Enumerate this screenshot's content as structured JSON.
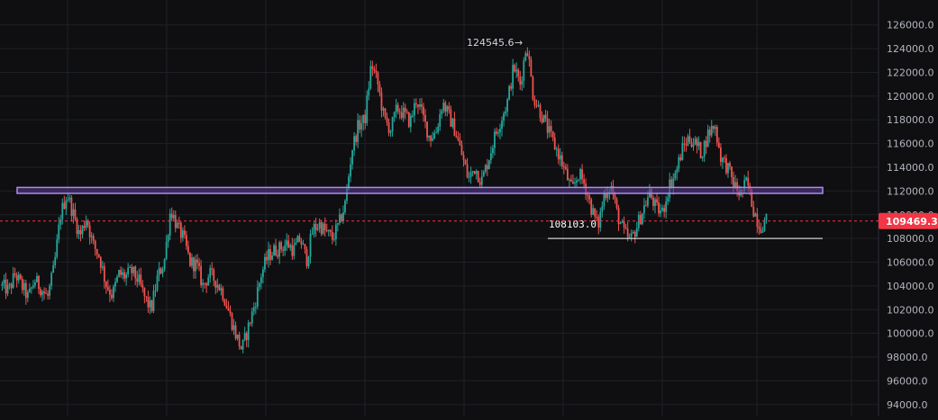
{
  "chart_data": {
    "type": "candlestick",
    "yticks": [
      "126000.0",
      "124000.0",
      "122000.0",
      "120000.0",
      "118000.0",
      "116000.0",
      "114000.0",
      "112000.0",
      "110000.0",
      "108000.0",
      "106000.0",
      "104000.0",
      "102000.0",
      "100000.0",
      "98000.0",
      "96000.0",
      "94000.0"
    ],
    "ytick_values": [
      126000,
      124000,
      122000,
      120000,
      118000,
      116000,
      114000,
      112000,
      110000,
      108000,
      106000,
      104000,
      102000,
      100000,
      98000,
      96000,
      94000
    ],
    "ylim": [
      93000,
      128100
    ],
    "current_price": 109469.3,
    "current_price_label": "109469.3",
    "high_label": "124545.6",
    "high_arrow": "→",
    "high_value": 124545.6,
    "support_label": "108103.0",
    "support_value": 108000,
    "resistance_zone": [
      111800,
      112300
    ],
    "price_path": [
      104000,
      103600,
      105000,
      104000,
      103000,
      104500,
      103800,
      103000,
      105500,
      110000,
      111800,
      110000,
      108200,
      109800,
      107500,
      106500,
      104200,
      103200,
      105000,
      104800,
      105200,
      104500,
      103000,
      102000,
      104800,
      106000,
      110500,
      109000,
      108000,
      106000,
      105800,
      104000,
      105000,
      104400,
      103500,
      101800,
      100000,
      98600,
      100500,
      102500,
      105000,
      106500,
      107000,
      107200,
      107600,
      107000,
      108000,
      106200,
      108800,
      109200,
      108500,
      108000,
      109200,
      111000,
      115500,
      117500,
      118000,
      122800,
      121000,
      118000,
      117200,
      119000,
      118500,
      117800,
      119800,
      118200,
      116500,
      117000,
      119500,
      118300,
      117000,
      115000,
      113000,
      114000,
      112800,
      114500,
      116500,
      118000,
      119500,
      122500,
      121000,
      124500,
      120000,
      118800,
      117500,
      116200,
      115000,
      113500,
      112000,
      113500,
      112500,
      110500,
      109000,
      111800,
      112500,
      110000,
      108500,
      107800,
      109000,
      110500,
      111800,
      110500,
      110200,
      112500,
      113500,
      115500,
      116500,
      116000,
      115200,
      116800,
      117600,
      114800,
      114000,
      112500,
      111700,
      112800,
      110500,
      109000,
      109500
    ],
    "colors": {
      "up": "#26a69a",
      "down": "#ef5350",
      "zone_fill": "#5b3a8c",
      "zone_stroke": "#a98df5",
      "price_tag": "#f23645",
      "support_line": "#ffffff"
    }
  }
}
